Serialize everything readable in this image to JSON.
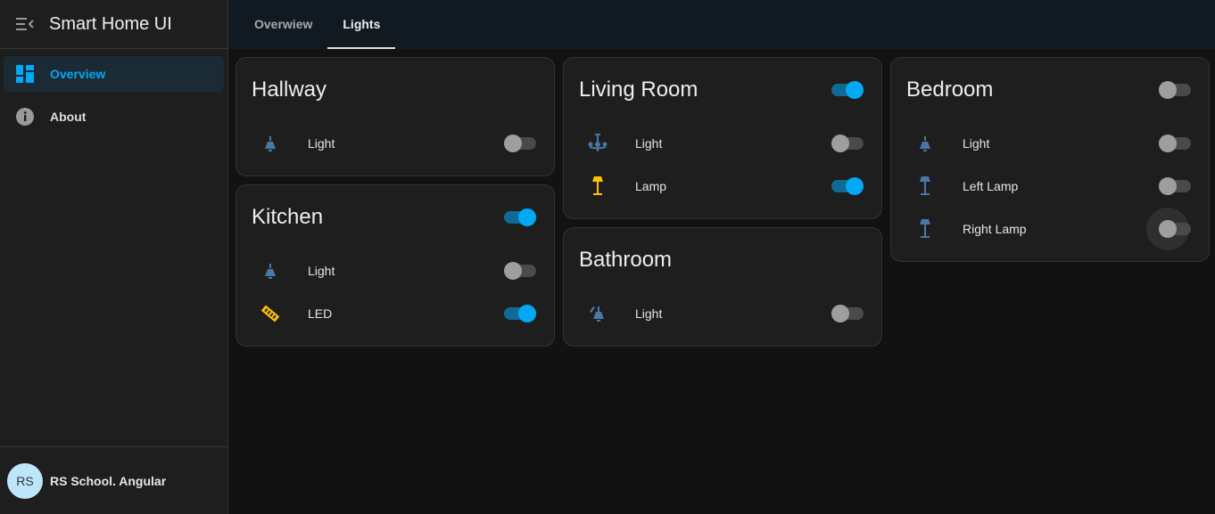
{
  "app": {
    "title": "Smart Home UI"
  },
  "sidebar": {
    "items": [
      {
        "label": "Overview",
        "icon": "dashboard-icon",
        "active": true
      },
      {
        "label": "About",
        "icon": "info-icon",
        "active": false
      }
    ],
    "footer": {
      "avatar": "RS",
      "name": "RS School. Angular"
    }
  },
  "tabs": [
    {
      "label": "Overwiew",
      "active": false
    },
    {
      "label": "Lights",
      "active": true
    }
  ],
  "colors": {
    "accent": "#03a9f4",
    "icon": "#4a77a8",
    "lamp_on": "#ffc107"
  },
  "rooms": {
    "hallway": {
      "title": "Hallway",
      "devices": [
        {
          "label": "Light",
          "icon": "ceiling-light-icon",
          "on": false
        }
      ]
    },
    "kitchen": {
      "title": "Kitchen",
      "on": true,
      "devices": [
        {
          "label": "Light",
          "icon": "ceiling-light-icon",
          "on": false
        },
        {
          "label": "LED",
          "icon": "led-strip-icon",
          "on": true
        }
      ]
    },
    "living": {
      "title": "Living Room",
      "on": true,
      "devices": [
        {
          "label": "Light",
          "icon": "chandelier-icon",
          "on": false
        },
        {
          "label": "Lamp",
          "icon": "floor-lamp-icon",
          "on": true
        }
      ]
    },
    "bathroom": {
      "title": "Bathroom",
      "devices": [
        {
          "label": "Light",
          "icon": "wall-light-icon",
          "on": false
        }
      ]
    },
    "bedroom": {
      "title": "Bedroom",
      "on": false,
      "devices": [
        {
          "label": "Light",
          "icon": "ceiling-light-icon",
          "on": false
        },
        {
          "label": "Left Lamp",
          "icon": "floor-lamp-icon",
          "on": false
        },
        {
          "label": "Right Lamp",
          "icon": "floor-lamp-icon",
          "on": false
        }
      ]
    }
  }
}
